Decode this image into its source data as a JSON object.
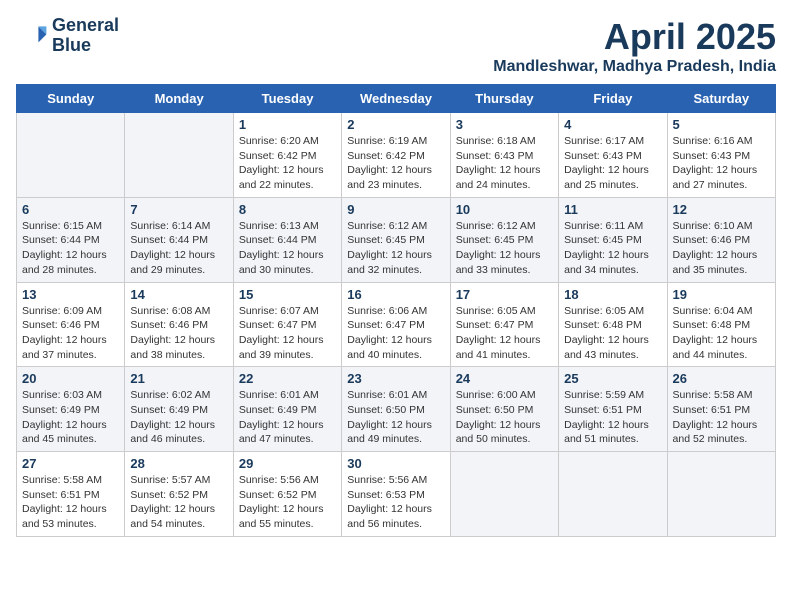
{
  "logo": {
    "line1": "General",
    "line2": "Blue"
  },
  "title": "April 2025",
  "location": "Mandleshwar, Madhya Pradesh, India",
  "days_of_week": [
    "Sunday",
    "Monday",
    "Tuesday",
    "Wednesday",
    "Thursday",
    "Friday",
    "Saturday"
  ],
  "weeks": [
    [
      {
        "num": "",
        "sunrise": "",
        "sunset": "",
        "daylight": ""
      },
      {
        "num": "",
        "sunrise": "",
        "sunset": "",
        "daylight": ""
      },
      {
        "num": "1",
        "sunrise": "6:20 AM",
        "sunset": "6:42 PM",
        "daylight": "12 hours and 22 minutes."
      },
      {
        "num": "2",
        "sunrise": "6:19 AM",
        "sunset": "6:42 PM",
        "daylight": "12 hours and 23 minutes."
      },
      {
        "num": "3",
        "sunrise": "6:18 AM",
        "sunset": "6:43 PM",
        "daylight": "12 hours and 24 minutes."
      },
      {
        "num": "4",
        "sunrise": "6:17 AM",
        "sunset": "6:43 PM",
        "daylight": "12 hours and 25 minutes."
      },
      {
        "num": "5",
        "sunrise": "6:16 AM",
        "sunset": "6:43 PM",
        "daylight": "12 hours and 27 minutes."
      }
    ],
    [
      {
        "num": "6",
        "sunrise": "6:15 AM",
        "sunset": "6:44 PM",
        "daylight": "12 hours and 28 minutes."
      },
      {
        "num": "7",
        "sunrise": "6:14 AM",
        "sunset": "6:44 PM",
        "daylight": "12 hours and 29 minutes."
      },
      {
        "num": "8",
        "sunrise": "6:13 AM",
        "sunset": "6:44 PM",
        "daylight": "12 hours and 30 minutes."
      },
      {
        "num": "9",
        "sunrise": "6:12 AM",
        "sunset": "6:45 PM",
        "daylight": "12 hours and 32 minutes."
      },
      {
        "num": "10",
        "sunrise": "6:12 AM",
        "sunset": "6:45 PM",
        "daylight": "12 hours and 33 minutes."
      },
      {
        "num": "11",
        "sunrise": "6:11 AM",
        "sunset": "6:45 PM",
        "daylight": "12 hours and 34 minutes."
      },
      {
        "num": "12",
        "sunrise": "6:10 AM",
        "sunset": "6:46 PM",
        "daylight": "12 hours and 35 minutes."
      }
    ],
    [
      {
        "num": "13",
        "sunrise": "6:09 AM",
        "sunset": "6:46 PM",
        "daylight": "12 hours and 37 minutes."
      },
      {
        "num": "14",
        "sunrise": "6:08 AM",
        "sunset": "6:46 PM",
        "daylight": "12 hours and 38 minutes."
      },
      {
        "num": "15",
        "sunrise": "6:07 AM",
        "sunset": "6:47 PM",
        "daylight": "12 hours and 39 minutes."
      },
      {
        "num": "16",
        "sunrise": "6:06 AM",
        "sunset": "6:47 PM",
        "daylight": "12 hours and 40 minutes."
      },
      {
        "num": "17",
        "sunrise": "6:05 AM",
        "sunset": "6:47 PM",
        "daylight": "12 hours and 41 minutes."
      },
      {
        "num": "18",
        "sunrise": "6:05 AM",
        "sunset": "6:48 PM",
        "daylight": "12 hours and 43 minutes."
      },
      {
        "num": "19",
        "sunrise": "6:04 AM",
        "sunset": "6:48 PM",
        "daylight": "12 hours and 44 minutes."
      }
    ],
    [
      {
        "num": "20",
        "sunrise": "6:03 AM",
        "sunset": "6:49 PM",
        "daylight": "12 hours and 45 minutes."
      },
      {
        "num": "21",
        "sunrise": "6:02 AM",
        "sunset": "6:49 PM",
        "daylight": "12 hours and 46 minutes."
      },
      {
        "num": "22",
        "sunrise": "6:01 AM",
        "sunset": "6:49 PM",
        "daylight": "12 hours and 47 minutes."
      },
      {
        "num": "23",
        "sunrise": "6:01 AM",
        "sunset": "6:50 PM",
        "daylight": "12 hours and 49 minutes."
      },
      {
        "num": "24",
        "sunrise": "6:00 AM",
        "sunset": "6:50 PM",
        "daylight": "12 hours and 50 minutes."
      },
      {
        "num": "25",
        "sunrise": "5:59 AM",
        "sunset": "6:51 PM",
        "daylight": "12 hours and 51 minutes."
      },
      {
        "num": "26",
        "sunrise": "5:58 AM",
        "sunset": "6:51 PM",
        "daylight": "12 hours and 52 minutes."
      }
    ],
    [
      {
        "num": "27",
        "sunrise": "5:58 AM",
        "sunset": "6:51 PM",
        "daylight": "12 hours and 53 minutes."
      },
      {
        "num": "28",
        "sunrise": "5:57 AM",
        "sunset": "6:52 PM",
        "daylight": "12 hours and 54 minutes."
      },
      {
        "num": "29",
        "sunrise": "5:56 AM",
        "sunset": "6:52 PM",
        "daylight": "12 hours and 55 minutes."
      },
      {
        "num": "30",
        "sunrise": "5:56 AM",
        "sunset": "6:53 PM",
        "daylight": "12 hours and 56 minutes."
      },
      {
        "num": "",
        "sunrise": "",
        "sunset": "",
        "daylight": ""
      },
      {
        "num": "",
        "sunrise": "",
        "sunset": "",
        "daylight": ""
      },
      {
        "num": "",
        "sunrise": "",
        "sunset": "",
        "daylight": ""
      }
    ]
  ],
  "labels": {
    "sunrise_prefix": "Sunrise: ",
    "sunset_prefix": "Sunset: ",
    "daylight_prefix": "Daylight: "
  }
}
